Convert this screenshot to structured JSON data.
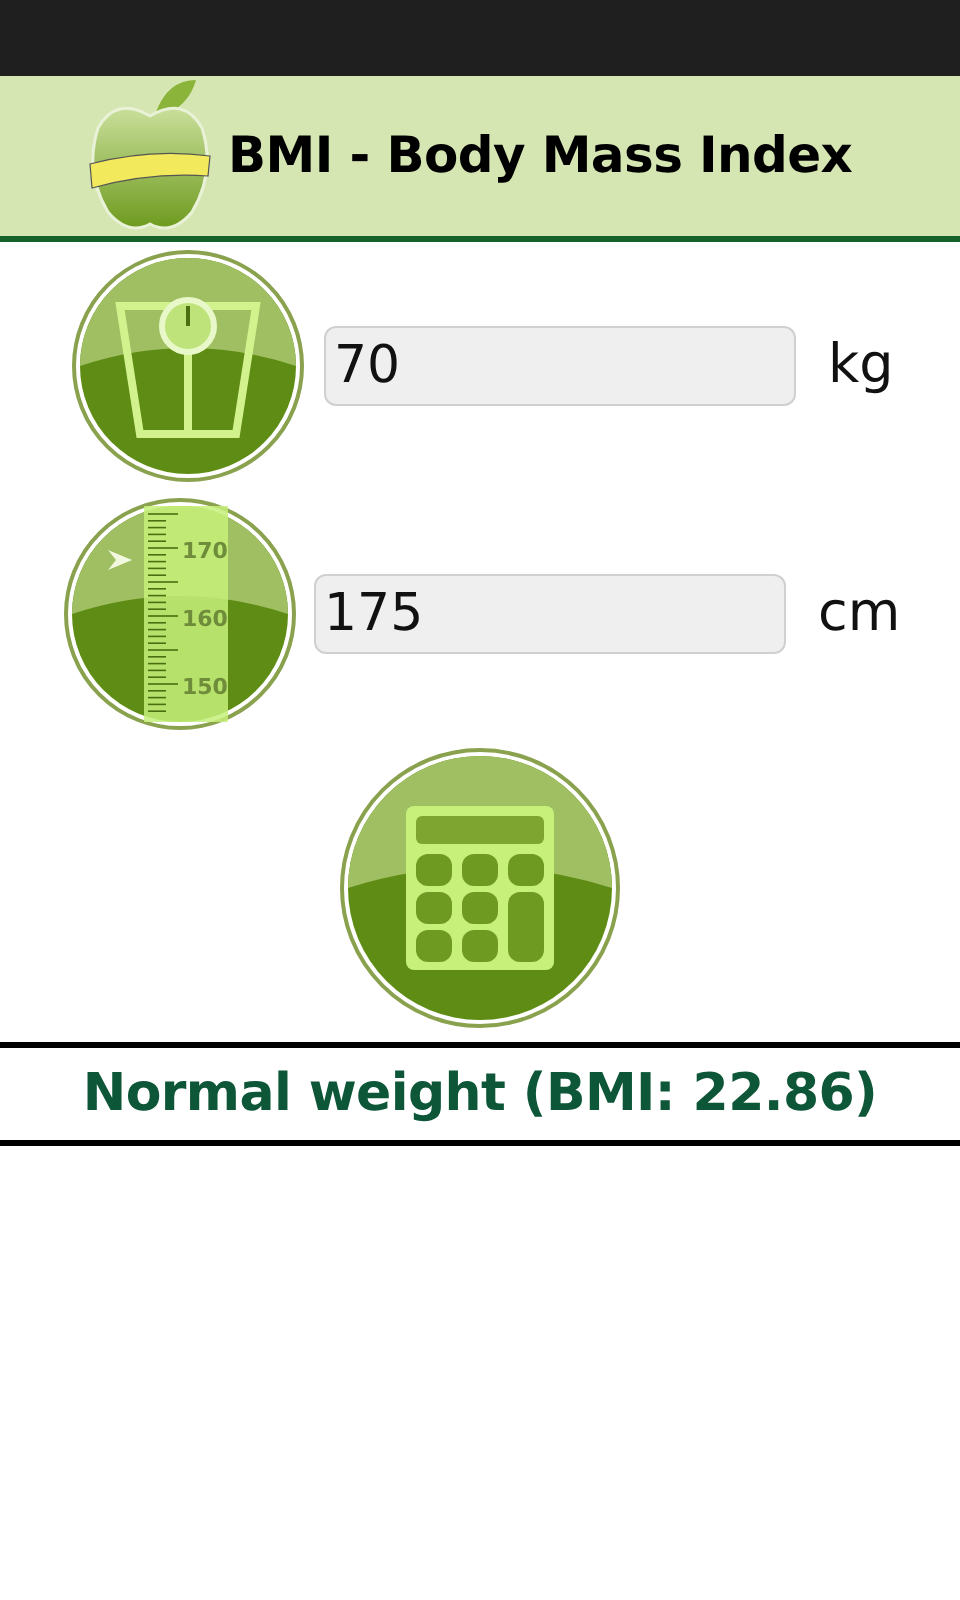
{
  "header": {
    "title": "BMI - Body Mass Index"
  },
  "inputs": [
    {
      "kind": "weight",
      "value": "70",
      "unit": "kg"
    },
    {
      "kind": "height",
      "value": "175",
      "unit": "cm",
      "ruler_marks": [
        "170",
        "160",
        "150"
      ]
    }
  ],
  "result": {
    "text": "Normal weight (BMI: 22.86)"
  }
}
